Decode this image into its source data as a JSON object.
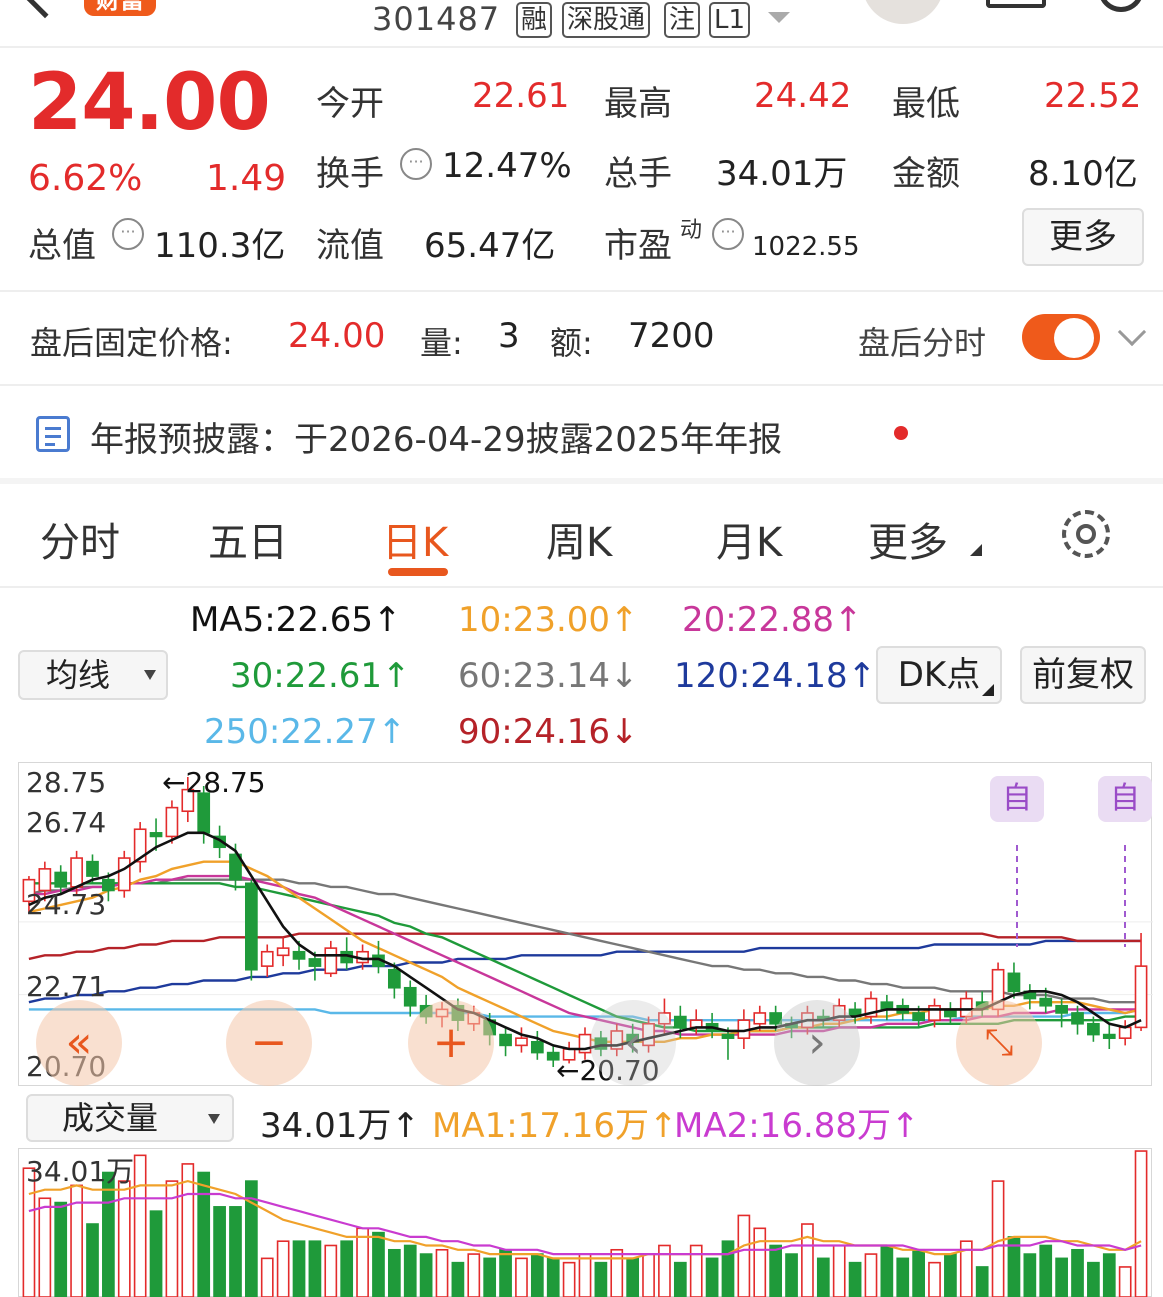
{
  "header": {
    "badge": "财富",
    "code": "301487",
    "tags": [
      "融",
      "深股通",
      "注",
      "L1"
    ]
  },
  "quote": {
    "price": "24.00",
    "change_pct": "6.62%",
    "change_amt": "1.49",
    "open_label": "今开",
    "open": "22.61",
    "high_label": "最高",
    "high": "24.42",
    "low_label": "最低",
    "low": "22.52",
    "turnover_label": "换手",
    "turnover": "12.47%",
    "volume_label": "总手",
    "volume": "34.01万",
    "amount_label": "金额",
    "amount": "8.10亿",
    "mktcap_label": "总值",
    "mktcap": "110.3亿",
    "float_label": "流值",
    "float_cap": "65.47亿",
    "pe_label": "市盈",
    "pe_sup": "动",
    "pe": "1022.55",
    "more_label": "更多"
  },
  "after_hours": {
    "price_label": "盘后固定价格:",
    "price": "24.00",
    "vol_label": "量:",
    "vol": "3",
    "amt_label": "额:",
    "amt": "7200",
    "timeshare_label": "盘后分时"
  },
  "notice": {
    "text": "年报预披露：于2026-04-29披露2025年年报"
  },
  "tabs": [
    {
      "label": "分时"
    },
    {
      "label": "五日"
    },
    {
      "label": "日K"
    },
    {
      "label": "周K"
    },
    {
      "label": "月K"
    },
    {
      "label": "更多"
    }
  ],
  "ma": {
    "selector": "均线",
    "ma5": "MA5:22.65↑",
    "ma10": "10:23.00↑",
    "ma20": "20:22.88↑",
    "ma30": "30:22.61↑",
    "ma60": "60:23.14↓",
    "ma120": "120:24.18↑",
    "ma250": "250:22.27↑",
    "ma90": "90:24.16↓",
    "dk_label": "DK点",
    "adjust_label": "前复权"
  },
  "kline": {
    "y_labels": [
      "28.75",
      "26.74",
      "24.73",
      "22.71",
      "20.70"
    ],
    "max_marker": "←28.75",
    "min_marker": "←20.70",
    "self_marker": "自"
  },
  "volume_bar": {
    "selector": "成交量",
    "vol": "34.01万↑",
    "ma1": "MA1:17.16万↑",
    "ma2": "MA2:16.88万↑",
    "top_label": "34.01万"
  },
  "colors": {
    "up": "#e32b2b",
    "down": "#1f9a3a",
    "accent": "#e8571e",
    "ma5": "#111111",
    "ma10": "#f0a12a",
    "ma20": "#c8379a",
    "ma30": "#1f9a3a",
    "ma60": "#777777",
    "ma120": "#1e3a9c",
    "ma250": "#5ab8e8",
    "ma90": "#b52228"
  },
  "chart_data": {
    "type": "candlestick",
    "ylim": [
      20.7,
      28.75
    ],
    "candles": [
      [
        25.3,
        25.9,
        25.0,
        26.0
      ],
      [
        25.6,
        26.2,
        25.3,
        26.4
      ],
      [
        26.1,
        25.7,
        25.5,
        26.3
      ],
      [
        25.7,
        26.5,
        25.5,
        26.7
      ],
      [
        26.4,
        26.0,
        25.8,
        26.6
      ],
      [
        25.9,
        25.6,
        25.3,
        26.1
      ],
      [
        25.6,
        26.5,
        25.4,
        26.7
      ],
      [
        26.4,
        27.3,
        26.1,
        27.5
      ],
      [
        27.2,
        27.1,
        26.7,
        27.6
      ],
      [
        27.1,
        27.9,
        26.9,
        28.1
      ],
      [
        27.8,
        28.4,
        27.5,
        28.75
      ],
      [
        28.3,
        27.2,
        26.9,
        28.5
      ],
      [
        27.1,
        26.8,
        26.5,
        27.4
      ],
      [
        26.6,
        25.9,
        25.6,
        26.9
      ],
      [
        25.8,
        23.4,
        23.1,
        25.9
      ],
      [
        23.5,
        23.9,
        23.2,
        24.1
      ],
      [
        23.8,
        24.0,
        23.5,
        24.3
      ],
      [
        23.9,
        23.7,
        23.4,
        24.2
      ],
      [
        23.7,
        23.5,
        23.1,
        23.9
      ],
      [
        23.3,
        24.0,
        23.2,
        24.2
      ],
      [
        23.9,
        23.6,
        23.4,
        24.3
      ],
      [
        23.6,
        23.9,
        23.4,
        24.1
      ],
      [
        23.8,
        23.5,
        23.3,
        24.2
      ],
      [
        23.4,
        22.9,
        22.6,
        23.6
      ],
      [
        22.9,
        22.4,
        22.1,
        23.1
      ],
      [
        22.4,
        22.1,
        21.9,
        22.7
      ],
      [
        22.1,
        22.3,
        21.8,
        22.5
      ],
      [
        22.4,
        22.0,
        21.7,
        22.6
      ],
      [
        21.9,
        22.2,
        21.7,
        22.4
      ],
      [
        22.0,
        21.6,
        21.3,
        22.2
      ],
      [
        21.6,
        21.3,
        21.0,
        21.8
      ],
      [
        21.3,
        21.5,
        21.1,
        21.8
      ],
      [
        21.4,
        21.1,
        20.9,
        21.7
      ],
      [
        21.1,
        20.9,
        20.7,
        21.3
      ],
      [
        20.9,
        21.2,
        20.8,
        21.4
      ],
      [
        21.1,
        21.6,
        20.9,
        21.8
      ],
      [
        21.5,
        21.2,
        21.0,
        21.7
      ],
      [
        21.2,
        21.7,
        21.0,
        21.9
      ],
      [
        21.6,
        21.4,
        21.1,
        21.9
      ],
      [
        21.3,
        21.9,
        21.1,
        22.1
      ],
      [
        21.9,
        22.2,
        21.6,
        22.6
      ],
      [
        22.1,
        21.8,
        21.5,
        22.4
      ],
      [
        21.8,
        22.0,
        21.6,
        22.3
      ],
      [
        21.9,
        21.7,
        21.5,
        22.2
      ],
      [
        21.6,
        21.5,
        20.9,
        21.8
      ],
      [
        21.5,
        22.0,
        21.2,
        22.3
      ],
      [
        21.9,
        22.2,
        21.7,
        22.4
      ],
      [
        22.2,
        21.9,
        21.7,
        22.4
      ],
      [
        21.9,
        21.8,
        21.5,
        22.1
      ],
      [
        21.8,
        22.2,
        21.6,
        22.4
      ],
      [
        22.1,
        22.0,
        21.8,
        22.3
      ],
      [
        22.0,
        22.4,
        21.8,
        22.6
      ],
      [
        22.3,
        22.1,
        21.9,
        22.5
      ],
      [
        22.1,
        22.6,
        21.9,
        22.8
      ],
      [
        22.5,
        22.3,
        22.0,
        22.7
      ],
      [
        22.4,
        22.2,
        22.0,
        22.6
      ],
      [
        22.2,
        22.0,
        21.8,
        22.4
      ],
      [
        22.0,
        22.4,
        21.8,
        22.6
      ],
      [
        22.3,
        22.1,
        21.9,
        22.5
      ],
      [
        22.1,
        22.6,
        21.9,
        22.8
      ],
      [
        22.5,
        22.3,
        22.1,
        22.8
      ],
      [
        22.3,
        23.4,
        22.1,
        23.6
      ],
      [
        23.3,
        22.8,
        22.6,
        23.6
      ],
      [
        22.8,
        22.6,
        22.3,
        23.0
      ],
      [
        22.6,
        22.4,
        22.2,
        22.9
      ],
      [
        22.4,
        22.2,
        21.8,
        22.6
      ],
      [
        22.2,
        21.9,
        21.6,
        22.4
      ],
      [
        21.9,
        21.6,
        21.4,
        22.1
      ],
      [
        21.6,
        21.5,
        21.2,
        21.9
      ],
      [
        21.5,
        21.8,
        21.3,
        22.0
      ],
      [
        21.8,
        23.5,
        21.7,
        24.42
      ]
    ],
    "ma5": [
      25.2,
      25.4,
      25.5,
      25.7,
      25.9,
      26.0,
      26.2,
      26.5,
      26.8,
      27.0,
      27.2,
      27.2,
      27.0,
      26.7,
      26.0,
      25.3,
      24.6,
      24.1,
      23.8,
      23.8,
      23.8,
      23.7,
      23.7,
      23.5,
      23.2,
      22.9,
      22.6,
      22.3,
      22.2,
      22.0,
      21.8,
      21.6,
      21.5,
      21.3,
      21.2,
      21.2,
      21.3,
      21.3,
      21.4,
      21.5,
      21.6,
      21.7,
      21.8,
      21.8,
      21.7,
      21.7,
      21.8,
      21.8,
      21.9,
      22.0,
      22.0,
      22.1,
      22.1,
      22.2,
      22.3,
      22.3,
      22.3,
      22.3,
      22.3,
      22.3,
      22.3,
      22.5,
      22.7,
      22.8,
      22.8,
      22.7,
      22.5,
      22.2,
      21.9,
      21.8,
      22.0
    ],
    "ma10": [
      25.0,
      25.1,
      25.2,
      25.3,
      25.4,
      25.6,
      25.7,
      25.9,
      26.0,
      26.2,
      26.3,
      26.4,
      26.4,
      26.4,
      26.2,
      26.0,
      25.7,
      25.4,
      25.1,
      24.8,
      24.5,
      24.2,
      24.0,
      23.8,
      23.6,
      23.4,
      23.2,
      22.9,
      22.7,
      22.5,
      22.3,
      22.1,
      21.9,
      21.7,
      21.6,
      21.5,
      21.4,
      21.4,
      21.4,
      21.4,
      21.4,
      21.5,
      21.5,
      21.6,
      21.6,
      21.7,
      21.7,
      21.7,
      21.8,
      21.8,
      21.9,
      21.9,
      22.0,
      22.1,
      22.1,
      22.2,
      22.2,
      22.3,
      22.3,
      22.3,
      22.3,
      22.4,
      22.4,
      22.5,
      22.5,
      22.5,
      22.5,
      22.4,
      22.3,
      22.2,
      22.3
    ],
    "ma20": [
      25.5,
      25.5,
      25.6,
      25.6,
      25.7,
      25.7,
      25.8,
      25.8,
      25.9,
      25.9,
      26.0,
      26.0,
      26.0,
      26.0,
      25.9,
      25.8,
      25.7,
      25.5,
      25.4,
      25.2,
      25.0,
      24.8,
      24.6,
      24.4,
      24.2,
      24.0,
      23.8,
      23.6,
      23.4,
      23.2,
      23.0,
      22.8,
      22.6,
      22.4,
      22.2,
      22.1,
      22.0,
      21.9,
      21.8,
      21.7,
      21.7,
      21.6,
      21.6,
      21.6,
      21.6,
      21.6,
      21.6,
      21.6,
      21.7,
      21.7,
      21.7,
      21.8,
      21.8,
      21.8,
      21.9,
      21.9,
      21.9,
      22.0,
      22.0,
      22.0,
      22.1,
      22.1,
      22.2,
      22.2,
      22.2,
      22.3,
      22.3,
      22.3,
      22.3,
      22.3,
      22.3
    ],
    "ma30": [
      25.8,
      25.8,
      25.8,
      25.8,
      25.8,
      25.8,
      25.8,
      25.8,
      25.8,
      25.8,
      25.8,
      25.8,
      25.8,
      25.7,
      25.7,
      25.6,
      25.5,
      25.4,
      25.3,
      25.2,
      25.1,
      25.0,
      24.9,
      24.7,
      24.6,
      24.4,
      24.3,
      24.1,
      23.9,
      23.7,
      23.5,
      23.3,
      23.1,
      22.9,
      22.7,
      22.5,
      22.3,
      22.1,
      22.0,
      21.9,
      21.8,
      21.8,
      21.7,
      21.7,
      21.7,
      21.7,
      21.7,
      21.7,
      21.8,
      21.8,
      21.8,
      21.8,
      21.8,
      21.8,
      21.8,
      21.8,
      21.8,
      21.9,
      21.9,
      21.9,
      21.9,
      21.9,
      22.0,
      22.0,
      22.0,
      22.0,
      22.0,
      22.0,
      22.0,
      22.1,
      22.1
    ],
    "ma60": [
      25.5,
      25.6,
      25.6,
      25.7,
      25.7,
      25.7,
      25.8,
      25.8,
      25.8,
      25.9,
      25.9,
      25.9,
      25.9,
      25.9,
      25.9,
      25.9,
      25.9,
      25.8,
      25.8,
      25.7,
      25.7,
      25.6,
      25.5,
      25.5,
      25.4,
      25.3,
      25.2,
      25.1,
      25.0,
      24.9,
      24.8,
      24.7,
      24.6,
      24.5,
      24.4,
      24.3,
      24.2,
      24.1,
      24.0,
      23.9,
      23.8,
      23.7,
      23.6,
      23.5,
      23.5,
      23.4,
      23.4,
      23.3,
      23.3,
      23.2,
      23.2,
      23.1,
      23.1,
      23.0,
      23.0,
      22.9,
      22.9,
      22.9,
      22.8,
      22.8,
      22.8,
      22.8,
      22.7,
      22.7,
      22.7,
      22.6,
      22.6,
      22.6,
      22.5,
      22.5,
      22.5
    ],
    "ma90": [
      23.7,
      23.8,
      23.8,
      23.9,
      23.9,
      24.0,
      24.0,
      24.1,
      24.1,
      24.2,
      24.2,
      24.2,
      24.3,
      24.3,
      24.3,
      24.3,
      24.3,
      24.4,
      24.4,
      24.4,
      24.4,
      24.4,
      24.4,
      24.4,
      24.4,
      24.4,
      24.4,
      24.4,
      24.4,
      24.4,
      24.4,
      24.4,
      24.4,
      24.4,
      24.4,
      24.4,
      24.4,
      24.4,
      24.4,
      24.4,
      24.4,
      24.4,
      24.4,
      24.4,
      24.4,
      24.4,
      24.4,
      24.4,
      24.4,
      24.4,
      24.4,
      24.4,
      24.4,
      24.4,
      24.4,
      24.4,
      24.4,
      24.4,
      24.4,
      24.4,
      24.4,
      24.3,
      24.3,
      24.3,
      24.3,
      24.3,
      24.2,
      24.2,
      24.2,
      24.2,
      24.2
    ],
    "ma120": [
      22.5,
      22.6,
      22.6,
      22.7,
      22.7,
      22.8,
      22.8,
      22.9,
      22.9,
      23.0,
      23.0,
      23.1,
      23.1,
      23.1,
      23.2,
      23.2,
      23.3,
      23.3,
      23.4,
      23.4,
      23.4,
      23.5,
      23.5,
      23.5,
      23.6,
      23.6,
      23.6,
      23.7,
      23.7,
      23.7,
      23.7,
      23.8,
      23.8,
      23.8,
      23.8,
      23.8,
      23.8,
      23.9,
      23.9,
      23.9,
      23.9,
      23.9,
      23.9,
      23.9,
      23.9,
      23.9,
      24.0,
      24.0,
      24.0,
      24.0,
      24.0,
      24.0,
      24.0,
      24.0,
      24.0,
      24.0,
      24.0,
      24.1,
      24.1,
      24.1,
      24.1,
      24.1,
      24.1,
      24.1,
      24.2,
      24.2,
      24.2,
      24.2,
      24.2,
      24.2,
      24.2
    ],
    "ma250": [
      22.3,
      22.3,
      22.3,
      22.3,
      22.3,
      22.3,
      22.3,
      22.3,
      22.3,
      22.3,
      22.3,
      22.3,
      22.3,
      22.3,
      22.3,
      22.3,
      22.3,
      22.3,
      22.3,
      22.2,
      22.2,
      22.2,
      22.2,
      22.2,
      22.2,
      22.2,
      22.2,
      22.2,
      22.2,
      22.1,
      22.1,
      22.1,
      22.1,
      22.1,
      22.1,
      22.1,
      22.1,
      22.1,
      22.1,
      22.0,
      22.0,
      22.0,
      22.0,
      22.0,
      22.0,
      22.0,
      22.0,
      22.0,
      22.0,
      22.0,
      22.0,
      22.0,
      22.0,
      22.0,
      22.0,
      22.0,
      22.0,
      22.0,
      22.0,
      22.1,
      22.1,
      22.1,
      22.1,
      22.1,
      22.1,
      22.1,
      22.2,
      22.2,
      22.2,
      22.2,
      22.3
    ],
    "volume": [
      30,
      23,
      22,
      26,
      17,
      29,
      27,
      33,
      20,
      27,
      31,
      29,
      21,
      21,
      27,
      9,
      13,
      13,
      13,
      12,
      13,
      16,
      15,
      11,
      12,
      10,
      11,
      8,
      10,
      9,
      11,
      9,
      10,
      9,
      8,
      10,
      8,
      11,
      9,
      10,
      12,
      8,
      12,
      9,
      13,
      19,
      16,
      12,
      10,
      17,
      9,
      12,
      8,
      10,
      12,
      9,
      11,
      8,
      10,
      13,
      7,
      27,
      14,
      10,
      12,
      9,
      11,
      8,
      10,
      7,
      34
    ],
    "vol_ma1": [
      24,
      25,
      25,
      26,
      25,
      25,
      25,
      26,
      26,
      26,
      27,
      26,
      25,
      24,
      22,
      20,
      18,
      17,
      16,
      15,
      14,
      14,
      14,
      13,
      13,
      12,
      12,
      11,
      11,
      10,
      10,
      10,
      10,
      9,
      9,
      9,
      9,
      9,
      9,
      10,
      10,
      10,
      10,
      10,
      10,
      12,
      13,
      13,
      13,
      14,
      13,
      13,
      12,
      12,
      12,
      11,
      11,
      10,
      10,
      11,
      11,
      13,
      14,
      14,
      14,
      13,
      13,
      12,
      11,
      11,
      13
    ],
    "vol_ma2": [
      20,
      21,
      21,
      22,
      22,
      22,
      23,
      23,
      23,
      23,
      24,
      24,
      24,
      23,
      23,
      22,
      21,
      20,
      19,
      18,
      17,
      16,
      16,
      15,
      14,
      14,
      13,
      13,
      12,
      12,
      11,
      11,
      11,
      10,
      10,
      10,
      10,
      10,
      10,
      10,
      10,
      10,
      10,
      10,
      10,
      11,
      11,
      11,
      12,
      12,
      12,
      12,
      12,
      12,
      12,
      12,
      11,
      11,
      11,
      11,
      11,
      12,
      12,
      12,
      13,
      13,
      12,
      12,
      12,
      11,
      12
    ],
    "vol_ylim": [
      0,
      34.01
    ]
  }
}
